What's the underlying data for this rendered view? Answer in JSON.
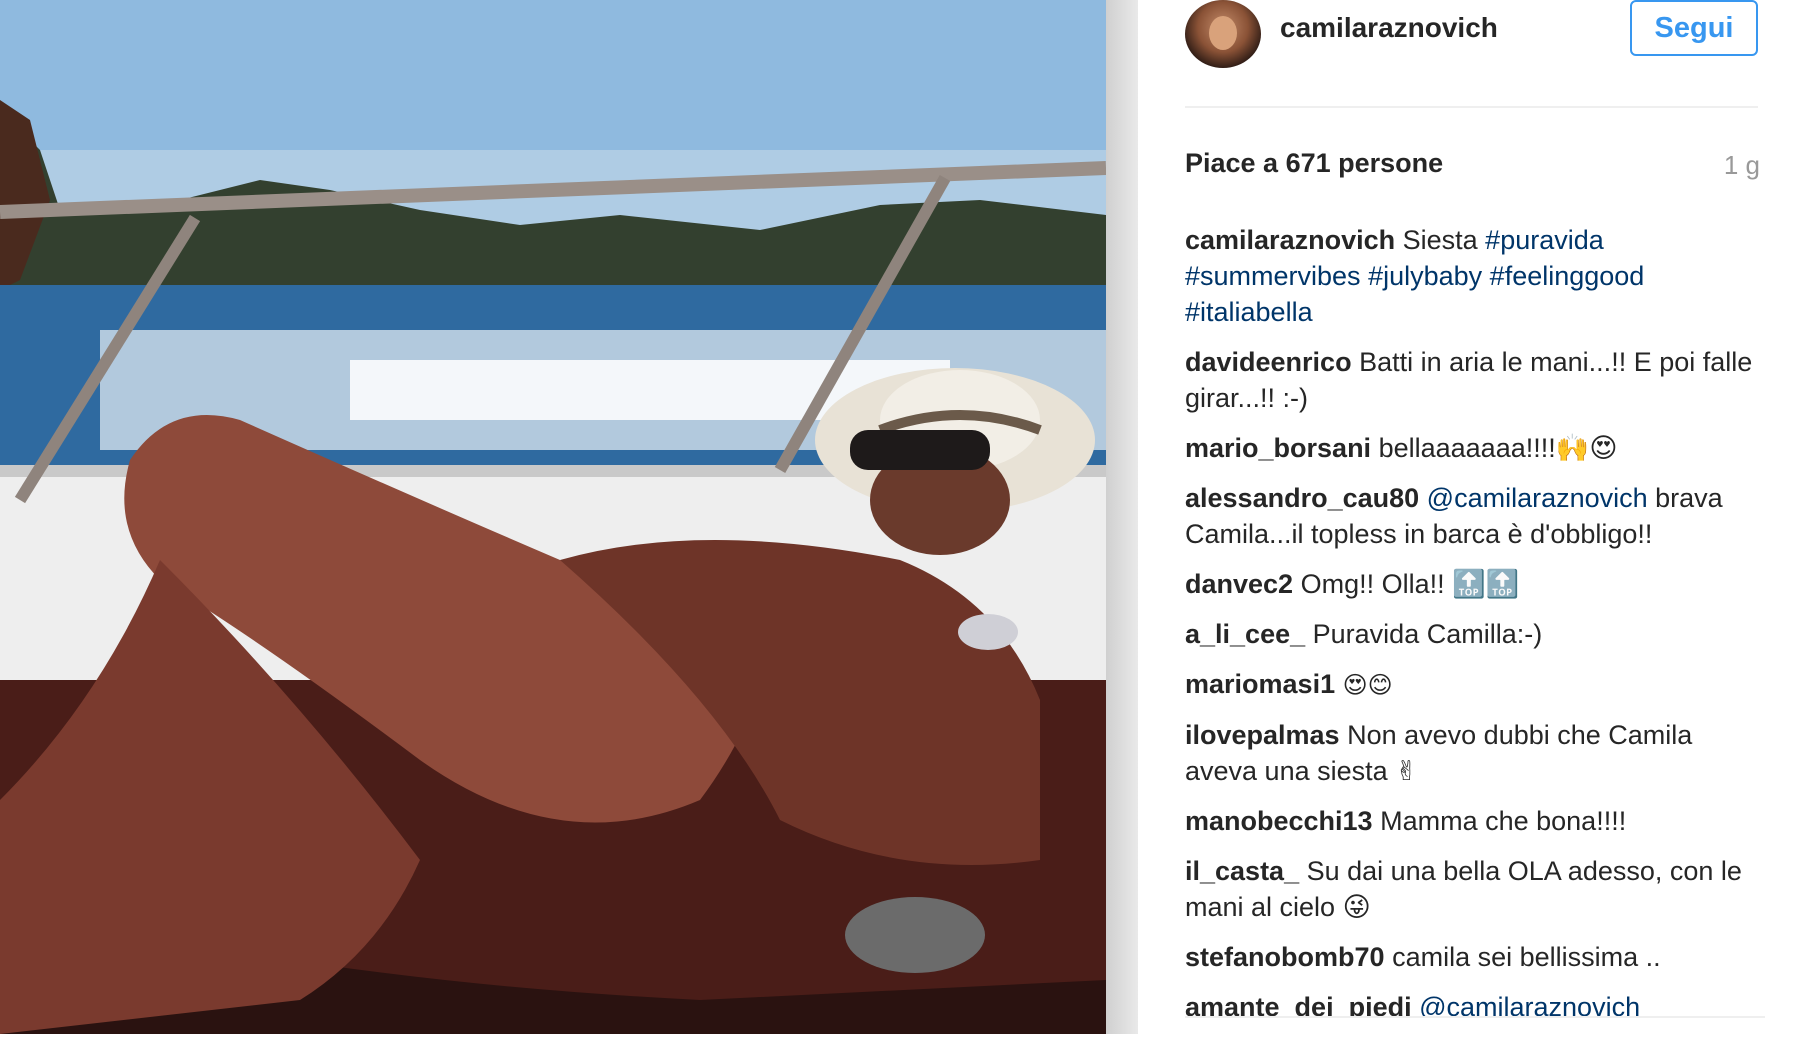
{
  "post": {
    "photo_alt": "",
    "username": "camilaraznovich",
    "follow_label": "Segui",
    "likes": "Piace a 671 persone",
    "age": "1 g"
  },
  "caption": {
    "user": "camilaraznovich",
    "text": "Siesta",
    "tags": [
      "#puravida",
      "#summervibes",
      "#julybaby",
      "#feelinggood",
      "#italiabella"
    ]
  },
  "comments": [
    {
      "user": "davideenrico",
      "text": "Batti in aria le mani...!! E poi falle girar...!! :-)"
    },
    {
      "user": "mario_borsani",
      "text": "bellaaaaaaa!!!!🙌😍"
    },
    {
      "user": "alessandro_cau80",
      "mention": "@camilaraznovich",
      "text": "brava Camila...il topless in barca è d'obbligo!!"
    },
    {
      "user": "danvec2",
      "text": "Omg!! Olla!! 🔝🔝"
    },
    {
      "user": "a_li_cee_",
      "text": "Puravida Camilla:-)"
    },
    {
      "user": "mariomasi1",
      "text": "😍😊"
    },
    {
      "user": "ilovepalmas",
      "text": "Non avevo dubbi che Camila aveva una siesta ✌"
    },
    {
      "user": "manobecchi13",
      "text": "Mamma che bona!!!!"
    },
    {
      "user": "il_casta_",
      "text": "Su dai una bella OLA adesso, con le mani al cielo 😜"
    },
    {
      "user": "stefanobomb70",
      "text": "camila sei bellissima .."
    },
    {
      "user": "amante_dei_piedi",
      "mention": "@camilaraznovich",
      "text": ""
    }
  ],
  "colors": {
    "follow_blue": "#3897f0",
    "hashtag": "#003569",
    "text": "#262626",
    "muted": "#999999"
  },
  "icons": {
    "avatar": "avatar"
  }
}
